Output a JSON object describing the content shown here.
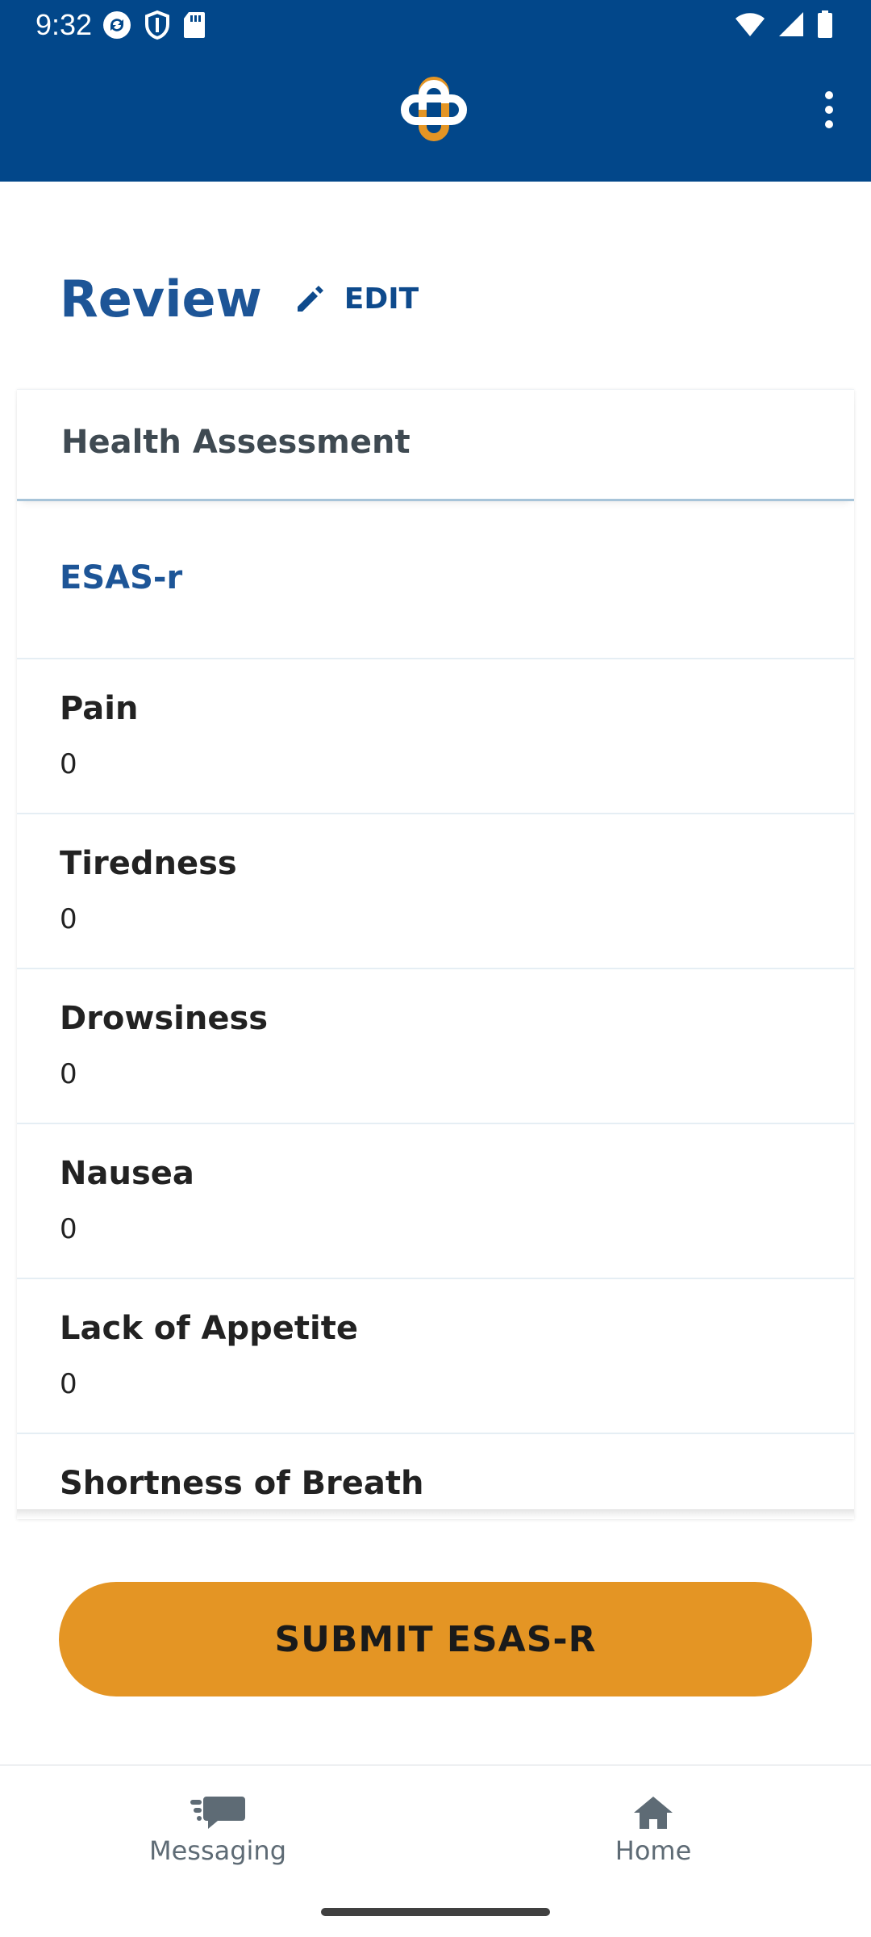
{
  "status_bar": {
    "time": "9:32"
  },
  "page": {
    "title": "Review",
    "edit_label": "EDIT"
  },
  "card": {
    "header_title": "Health Assessment",
    "section_title": "ESAS-r",
    "items": [
      {
        "label": "Pain",
        "value": "0"
      },
      {
        "label": "Tiredness",
        "value": "0"
      },
      {
        "label": "Drowsiness",
        "value": "0"
      },
      {
        "label": "Nausea",
        "value": "0"
      },
      {
        "label": "Lack of Appetite",
        "value": "0"
      },
      {
        "label": "Shortness of Breath",
        "value": ""
      }
    ]
  },
  "submit_label": "SUBMIT ESAS-R",
  "bottom_nav": {
    "items": [
      {
        "label": "Messaging",
        "icon": "messaging-icon"
      },
      {
        "label": "Home",
        "icon": "home-icon"
      }
    ]
  },
  "colors": {
    "brand_blue": "#02478a",
    "accent_orange": "#e49524",
    "title_blue": "#1d5597"
  }
}
